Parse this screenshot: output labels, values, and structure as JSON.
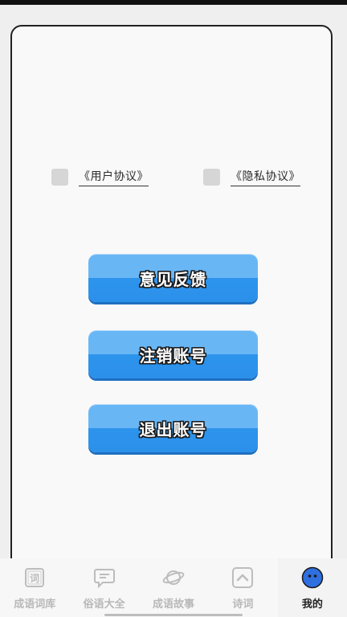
{
  "agreements": {
    "user_agreement": "《用户协议》",
    "privacy_policy": "《隐私协议》"
  },
  "actions": {
    "feedback": "意见反馈",
    "delete_account": "注销账号",
    "logout": "退出账号"
  },
  "tabbar": {
    "active_tab": "mine",
    "tabs": [
      {
        "id": "idiom-dict",
        "label": "成语词库",
        "icon": "dictionary-icon"
      },
      {
        "id": "proverbs",
        "label": "俗语大全",
        "icon": "chat-bubble-icon"
      },
      {
        "id": "idiom-stories",
        "label": "成语故事",
        "icon": "planet-icon"
      },
      {
        "id": "poetry",
        "label": "诗词",
        "icon": "chevron-up-icon"
      },
      {
        "id": "mine",
        "label": "我的",
        "icon": "avatar-icon"
      }
    ]
  },
  "colors": {
    "button_top": "#69b6f5",
    "button_bottom": "#2d94ec",
    "active_avatar": "#2f6fe0",
    "inactive_tab": "#b8b8b8"
  }
}
